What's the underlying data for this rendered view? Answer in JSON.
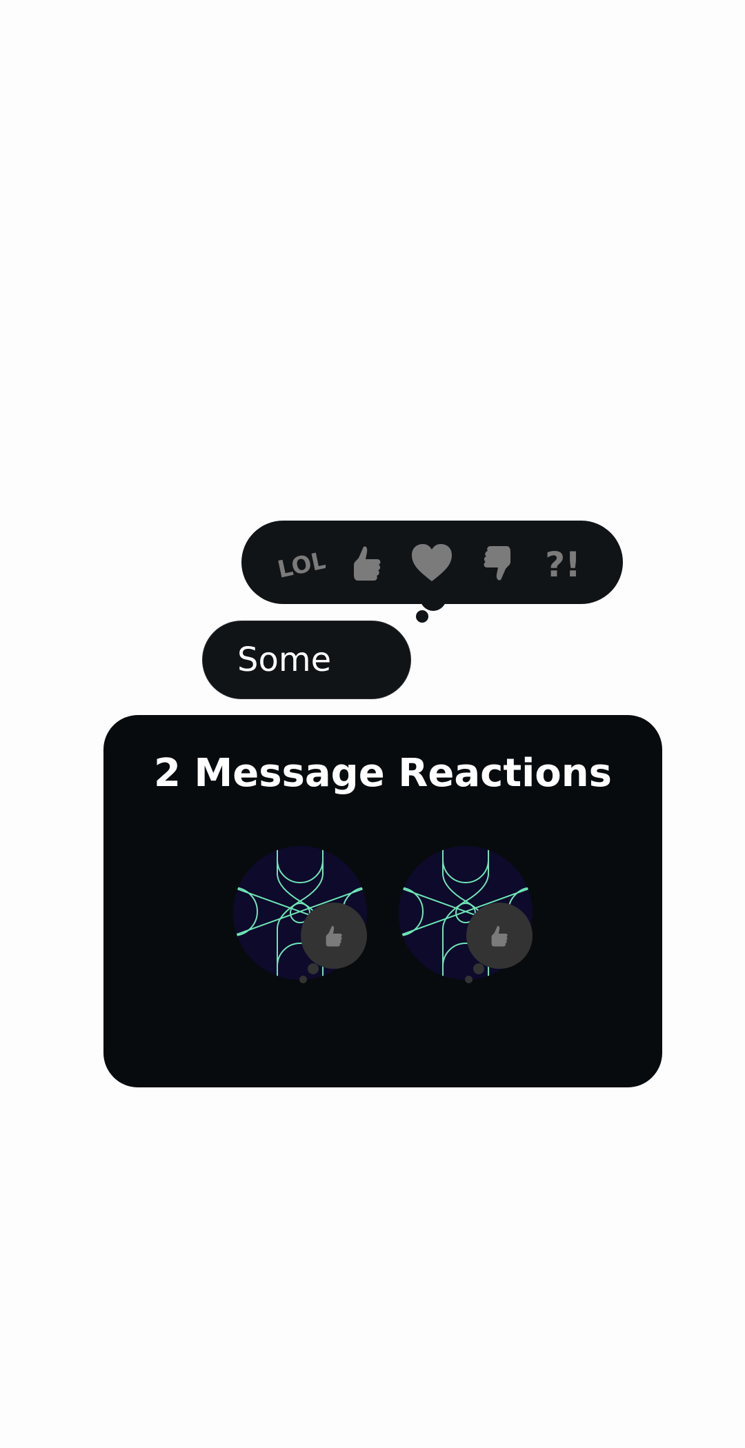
{
  "reaction_picker": {
    "reactions": [
      {
        "name": "lol",
        "label": "LOL"
      },
      {
        "name": "thumbs-up",
        "label": "thumbs up"
      },
      {
        "name": "heart",
        "label": "love"
      },
      {
        "name": "thumbs-down",
        "label": "thumbs down"
      },
      {
        "name": "question-exclaim",
        "label": "?!"
      }
    ],
    "icon_color": "#7b7b7b",
    "background": "#111417"
  },
  "message": {
    "text": "Some"
  },
  "reactions_panel": {
    "title": "2 Message Reactions",
    "users": [
      {
        "avatar": "geometric-pattern-avatar",
        "reaction": "thumbs-up-icon"
      },
      {
        "avatar": "geometric-pattern-avatar",
        "reaction": "thumbs-up-icon"
      }
    ],
    "accent": "#6ee7b7"
  }
}
